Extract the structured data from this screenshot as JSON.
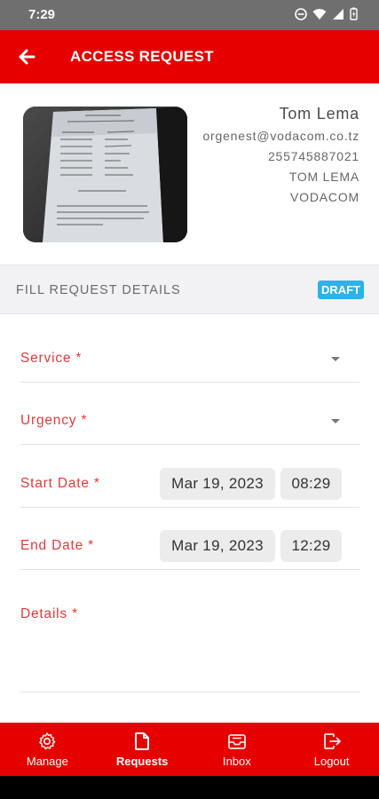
{
  "status_bar": {
    "time": "7:29"
  },
  "header": {
    "title": "ACCESS REQUEST"
  },
  "profile": {
    "name": "Tom Lema",
    "email": "orgenest@vodacom.co.tz",
    "phone": "255745887021",
    "full_name_caps": "TOM LEMA",
    "company": "VODACOM"
  },
  "section": {
    "title": "FILL REQUEST DETAILS",
    "badge": "DRAFT"
  },
  "form": {
    "service_label": "Service *",
    "urgency_label": "Urgency *",
    "start_date_label": "Start Date *",
    "start_date_value": "Mar 19, 2023",
    "start_time_value": "08:29",
    "end_date_label": "End Date *",
    "end_date_value": "Mar 19, 2023",
    "end_time_value": "12:29",
    "details_label": "Details *"
  },
  "bottom_nav": {
    "items": [
      {
        "label": "Manage",
        "icon": "gear-icon"
      },
      {
        "label": "Requests",
        "icon": "document-icon",
        "active": true
      },
      {
        "label": "Inbox",
        "icon": "inbox-icon"
      },
      {
        "label": "Logout",
        "icon": "logout-icon"
      }
    ]
  },
  "colors": {
    "brand": "#e60000",
    "badge": "#2bb3ea",
    "label": "#e03a3a"
  }
}
